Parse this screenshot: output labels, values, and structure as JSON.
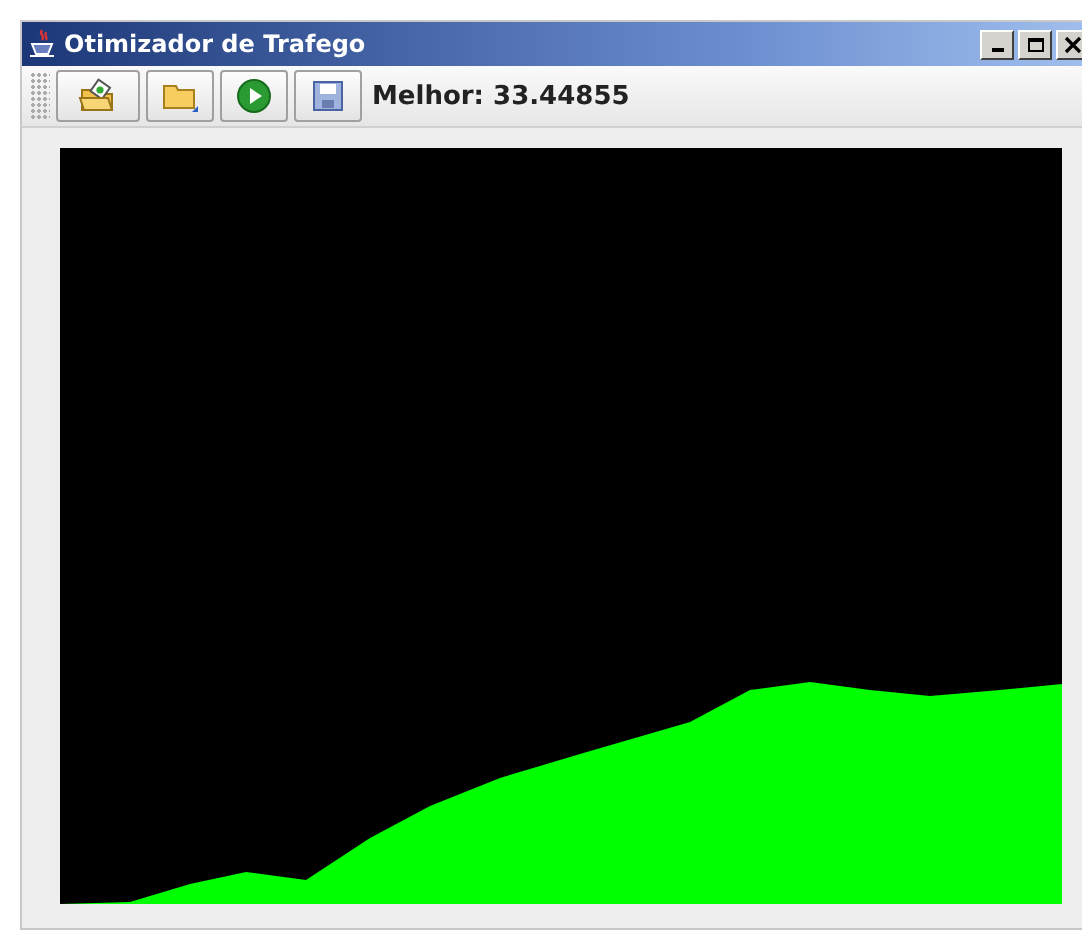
{
  "window": {
    "title": "Otimizador de Trafego"
  },
  "toolbar": {
    "best_label": "Melhor: 33.44855"
  }
}
